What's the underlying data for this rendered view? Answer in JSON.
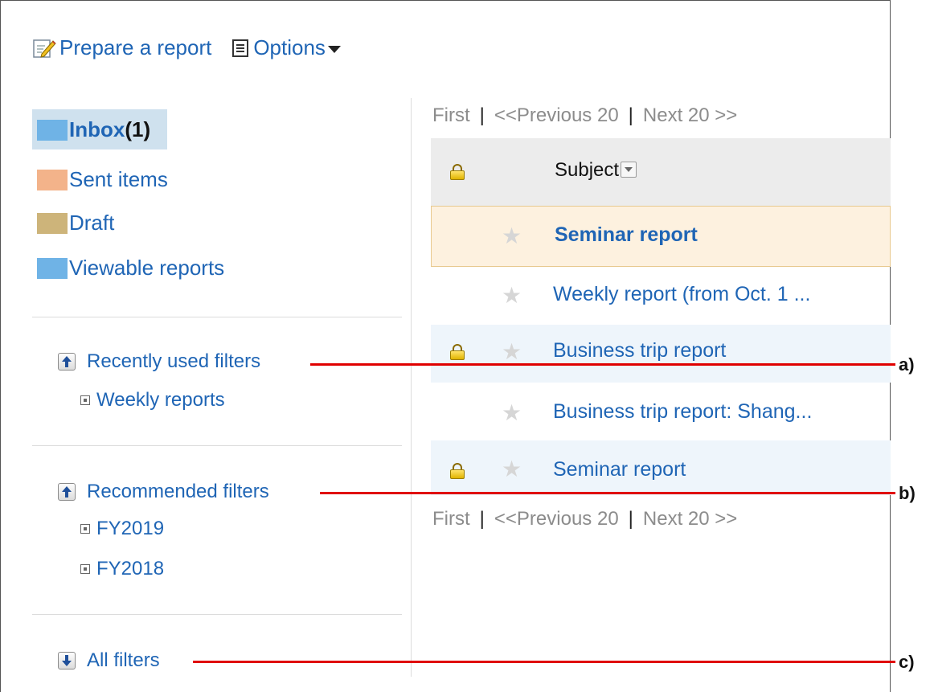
{
  "toolbar": {
    "prepare_label": "Prepare a report",
    "options_label": "Options"
  },
  "folders": [
    {
      "name": "Inbox",
      "count": "(1)",
      "color": "#6fb3e6",
      "selected": true
    },
    {
      "name": "Sent items",
      "color": "#f3b38a"
    },
    {
      "name": "Draft",
      "color": "#cdb47a"
    },
    {
      "name": "Viewable reports",
      "color": "#6fb3e6"
    }
  ],
  "filters": {
    "recent": {
      "label": "Recently used filters",
      "items": [
        "Weekly reports"
      ]
    },
    "recommended": {
      "label": "Recommended filters",
      "items": [
        "FY2019",
        "FY2018"
      ]
    },
    "all": {
      "label": "All filters"
    }
  },
  "pager": {
    "first": "First",
    "prev": "<<Previous 20",
    "next": "Next 20 >>",
    "sep": "|"
  },
  "list": {
    "subject_header": "Subject",
    "rows": [
      {
        "subject": "Seminar report",
        "locked": false,
        "bold": true
      },
      {
        "subject": "Weekly report (from Oct. 1 ...",
        "locked": false,
        "bold": false
      },
      {
        "subject": "Business trip report",
        "locked": true,
        "bold": false
      },
      {
        "subject": "Business trip report: Shang...",
        "locked": false,
        "bold": false
      },
      {
        "subject": "Seminar report",
        "locked": true,
        "bold": false
      }
    ]
  },
  "callouts": {
    "a": "a)",
    "b": "b)",
    "c": "c)"
  },
  "colors": {
    "link": "#1f65b5",
    "callout": "#e00000",
    "selected_row": "#fdf1df"
  }
}
